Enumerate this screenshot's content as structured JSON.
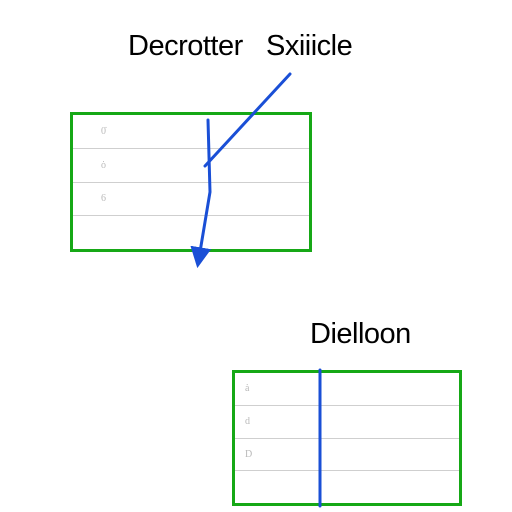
{
  "labels": {
    "top_left": "Decrotter",
    "top_right": "Sxiiicle",
    "bottom": "Dielloon"
  },
  "colors": {
    "border": "#16a816",
    "line": "#1a4fd6",
    "grid": "#cfcfcf"
  },
  "top_grid": {
    "rows": [
      {
        "a": "",
        "b": "0̇"
      },
      {
        "a": "",
        "b": "ȯ"
      },
      {
        "a": "",
        "b": "6"
      },
      {
        "a": "",
        "b": ""
      }
    ]
  },
  "bottom_grid": {
    "rows": [
      {
        "a": "ȧ",
        "b": ""
      },
      {
        "a": "d",
        "b": ""
      },
      {
        "a": "D",
        "b": ""
      },
      {
        "a": "",
        "b": ""
      }
    ]
  }
}
